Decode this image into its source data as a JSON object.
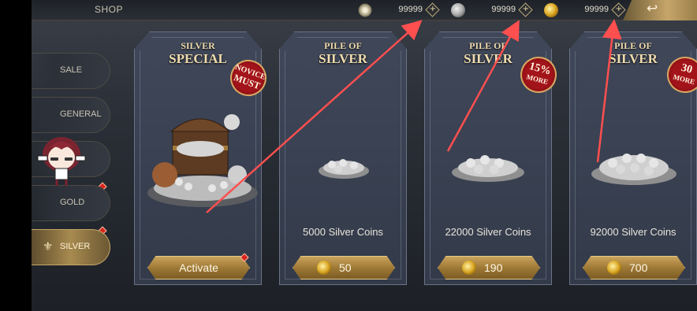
{
  "header": {
    "title": "SHOP",
    "currencies": [
      {
        "icon": "gem-icon",
        "value": "99999"
      },
      {
        "icon": "silver-coin-icon",
        "value": "99999"
      },
      {
        "icon": "gold-coin-icon",
        "value": "99999"
      }
    ],
    "plus_symbol": "+",
    "back_symbol": "↩"
  },
  "sidebar": {
    "items": [
      {
        "label": "SALE",
        "active": false
      },
      {
        "label": "GENERAL",
        "active": false
      },
      {
        "label": "",
        "active": false
      },
      {
        "label": "GOLD",
        "active": false
      },
      {
        "label": "SILVER",
        "active": true
      }
    ],
    "active_icon": "⚜"
  },
  "cards": [
    {
      "title_line1": "SILVER",
      "title_line2": "SPECIAL",
      "badge_line1": "NOVICE",
      "badge_line2": "MUST",
      "caption": "",
      "button_label": "Activate",
      "price": ""
    },
    {
      "title_line1": "PILE OF",
      "title_line2": "SILVER",
      "caption": "5000 Silver Coins",
      "price": "50"
    },
    {
      "title_line1": "PILE OF",
      "title_line2": "SILVER",
      "badge_line1": "15%",
      "badge_line2": "MORE",
      "caption": "22000 Silver Coins",
      "price": "190"
    },
    {
      "title_line1": "PILE OF",
      "title_line2": "SILVER",
      "badge_line1": "30",
      "badge_line2": "MORE",
      "caption": "92000 Silver Coins",
      "price": "700"
    }
  ],
  "colors": {
    "accent_gold": "#c9a35c",
    "annotation_red": "#ff4f4f",
    "card_bg": "#3b4253"
  }
}
